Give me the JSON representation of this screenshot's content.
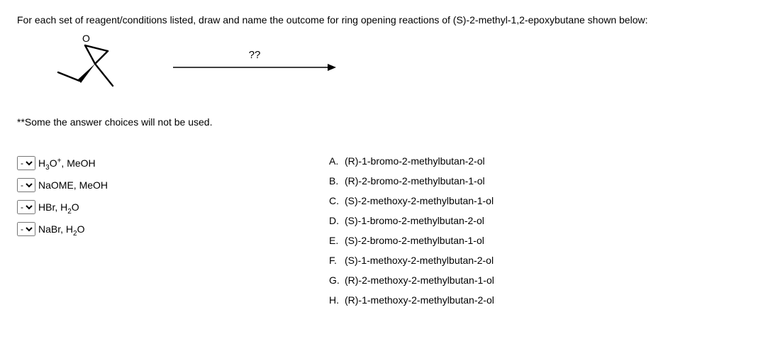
{
  "question": "For each set of reagent/conditions listed, draw and name the outcome for ring opening reactions of (S)-2-methyl-1,2-epoxybutane shown below:",
  "arrow_label": "??",
  "note": "**Some the answer choices will not be used.",
  "select_placeholder": "-",
  "reagents": [
    {
      "html": "H<sub>3</sub>O<sup>+</sup>, MeOH"
    },
    {
      "html": "NaOME, MeOH"
    },
    {
      "html": "HBr, H<sub>2</sub>O"
    },
    {
      "html": "NaBr, H<sub>2</sub>O"
    }
  ],
  "answers": [
    {
      "letter": "A.",
      "text": "(R)-1-bromo-2-methylbutan-2-ol"
    },
    {
      "letter": "B.",
      "text": "(R)-2-bromo-2-methylbutan-1-ol"
    },
    {
      "letter": "C.",
      "text": "(S)-2-methoxy-2-methylbutan-1-ol"
    },
    {
      "letter": "D.",
      "text": "(S)-1-bromo-2-methylbutan-2-ol"
    },
    {
      "letter": "E.",
      "text": "(S)-2-bromo-2-methylbutan-1-ol"
    },
    {
      "letter": "F.",
      "text": "(S)-1-methoxy-2-methylbutan-2-ol"
    },
    {
      "letter": "G.",
      "text": "(R)-2-methoxy-2-methylbutan-1-ol"
    },
    {
      "letter": "H.",
      "text": "(R)-1-methoxy-2-methylbutan-2-ol"
    }
  ]
}
